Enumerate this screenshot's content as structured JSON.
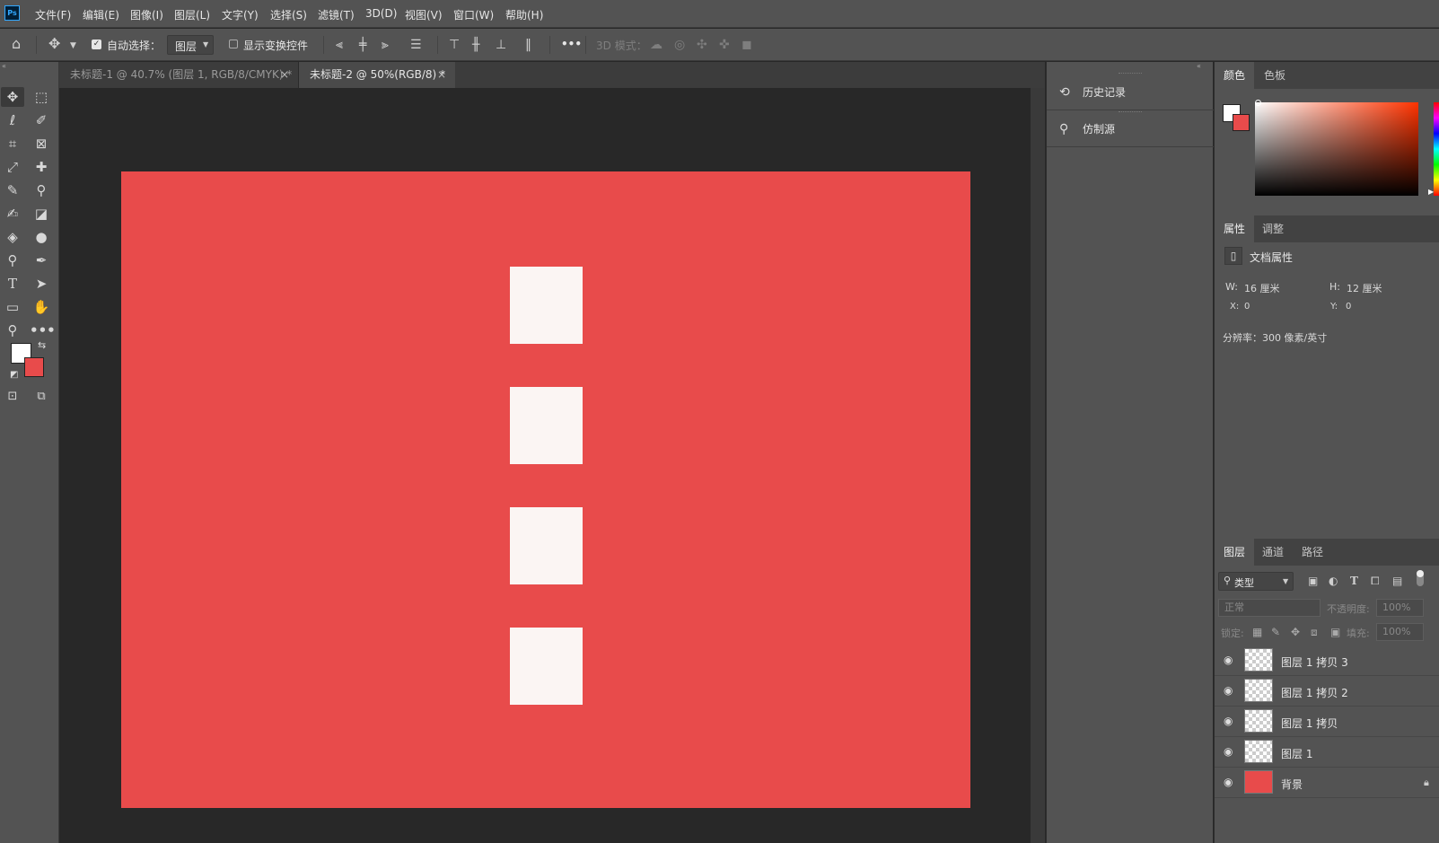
{
  "app": {
    "logo_text": "Ps",
    "accent": "#31a8ff"
  },
  "menu": [
    "文件(F)",
    "编辑(E)",
    "图像(I)",
    "图层(L)",
    "文字(Y)",
    "选择(S)",
    "滤镜(T)",
    "3D(D)",
    "视图(V)",
    "窗口(W)",
    "帮助(H)"
  ],
  "options": {
    "auto_select_label": "自动选择：",
    "auto_select_checked": true,
    "auto_select_target": "图层",
    "show_transform_label": "显示变换控件",
    "more_label": "•••",
    "mode3d_label": "3D 模式："
  },
  "tabs": [
    {
      "label": "未标题-1 @ 40.7% (图层 1, RGB/8/CMYK) *",
      "close": "×",
      "active": false
    },
    {
      "label": "未标题-2 @ 50%(RGB/8) *",
      "close": "×",
      "active": true
    }
  ],
  "canvas": {
    "background": "#e84b4b",
    "square_color": "#fbf5f3",
    "square_count": 4
  },
  "mid_panel": {
    "history_label": "历史记录",
    "clone_source_label": "仿制源"
  },
  "color_panel": {
    "tabs": [
      "颜色",
      "色板"
    ],
    "foreground": "#ffffff",
    "background": "#e84b4b",
    "hue": "#ff3300"
  },
  "properties_panel": {
    "tabs": [
      "属性",
      "调整"
    ],
    "section_title": "文档属性",
    "w_label": "W:",
    "w_value": "16 厘米",
    "h_label": "H:",
    "h_value": "12 厘米",
    "x_label": "X:",
    "x_value": "0",
    "y_label": "Y:",
    "y_value": "0",
    "resolution": "分辨率：300 像素/英寸"
  },
  "layers_panel": {
    "tabs": [
      "图层",
      "通道",
      "路径"
    ],
    "filter_label": "类型",
    "blend_mode": "正常",
    "opacity_label": "不透明度:",
    "opacity_value": "100%",
    "lock_label": "锁定:",
    "fill_label": "填充:",
    "fill_value": "100%",
    "layers": [
      {
        "name": "图层 1 拷贝 3",
        "transparent": true
      },
      {
        "name": "图层 1 拷贝 2",
        "transparent": true
      },
      {
        "name": "图层 1 拷贝",
        "transparent": true
      },
      {
        "name": "图层 1",
        "transparent": true
      },
      {
        "name": "背景",
        "transparent": false,
        "locked": true
      }
    ]
  }
}
